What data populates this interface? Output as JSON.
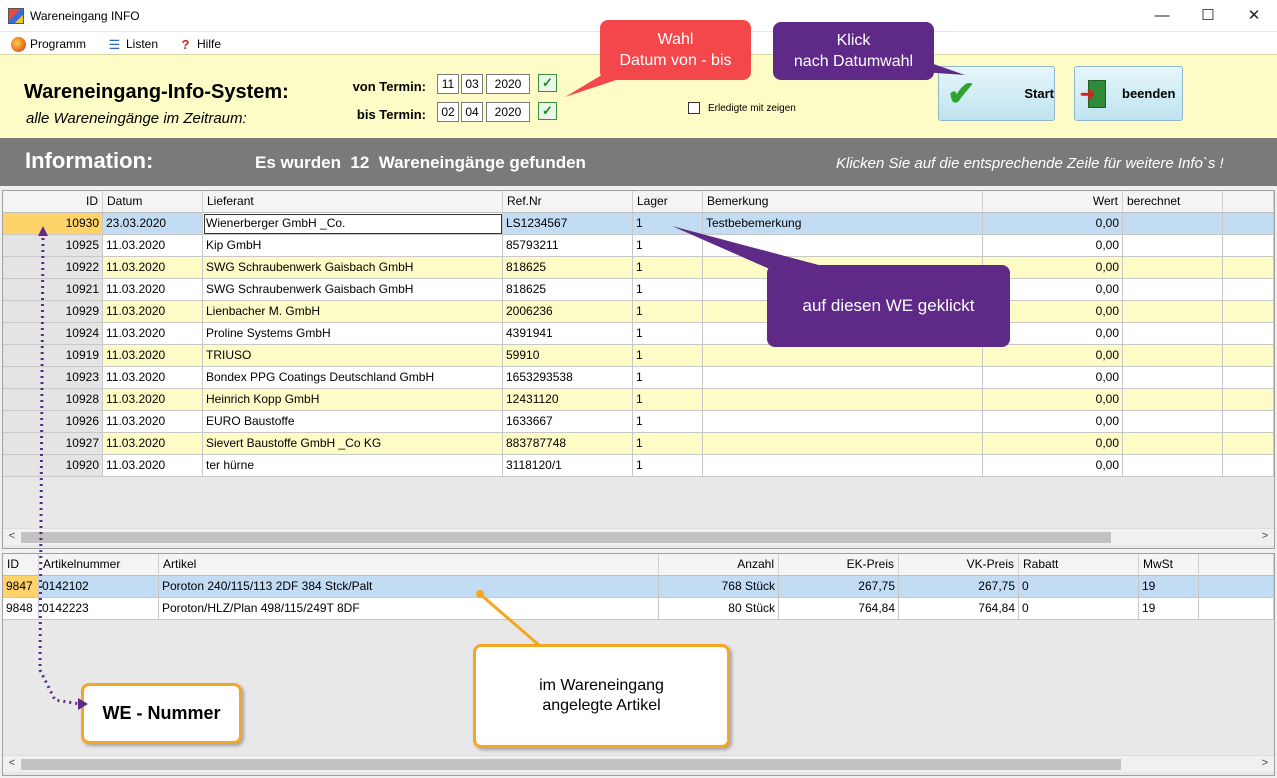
{
  "window": {
    "title": "Wareneingang INFO",
    "minimize": "—",
    "maximize": "☐",
    "close": "✕"
  },
  "menu": [
    {
      "label": "Programm",
      "icon": "program-icon"
    },
    {
      "label": "Listen",
      "icon": "list-icon"
    },
    {
      "label": "Hilfe",
      "icon": "help-icon"
    }
  ],
  "header": {
    "title": "Wareneingang-Info-System:",
    "subtitle": "alle Wareneingänge im Zeitraum:",
    "von_label": "von Termin:",
    "bis_label": "bis Termin:",
    "von": {
      "day": "11",
      "month": "03",
      "year": "2020"
    },
    "bis": {
      "day": "02",
      "month": "04",
      "year": "2020"
    },
    "checkbox_label": "Erledigte mit zeigen",
    "checkbox_checked": false,
    "start_label": "Start",
    "end_label": "beenden"
  },
  "info": {
    "title": "Information:",
    "message": "Es wurden  12  Wareneingänge gefunden",
    "hint": "Klicken Sie auf die entsprechende Zeile für weitere Info`s !"
  },
  "top_table": {
    "columns": [
      "ID",
      "Datum",
      "Lieferant",
      "Ref.Nr",
      "Lager",
      "Bemerkung",
      "Wert",
      "berechnet"
    ],
    "rows": [
      [
        "10930",
        "23.03.2020",
        "Wienerberger GmbH _Co.",
        "LS1234567",
        "1",
        "Testbebemerkung",
        "0,00",
        ""
      ],
      [
        "10925",
        "11.03.2020",
        "Kip GmbH",
        "85793211",
        "1",
        "",
        "0,00",
        ""
      ],
      [
        "10922",
        "11.03.2020",
        "SWG Schraubenwerk Gaisbach GmbH",
        "818625",
        "1",
        "",
        "0,00",
        ""
      ],
      [
        "10921",
        "11.03.2020",
        "SWG Schraubenwerk Gaisbach GmbH",
        "818625",
        "1",
        "",
        "0,00",
        ""
      ],
      [
        "10929",
        "11.03.2020",
        "Lienbacher M. GmbH",
        "2006236",
        "1",
        "",
        "0,00",
        ""
      ],
      [
        "10924",
        "11.03.2020",
        "Proline Systems GmbH",
        "4391941",
        "1",
        "",
        "0,00",
        ""
      ],
      [
        "10919",
        "11.03.2020",
        "TRIUSO",
        "59910",
        "1",
        "",
        "0,00",
        ""
      ],
      [
        "10923",
        "11.03.2020",
        "Bondex PPG Coatings  Deutschland GmbH",
        "1653293538",
        "1",
        "",
        "0,00",
        ""
      ],
      [
        "10928",
        "11.03.2020",
        "Heinrich Kopp GmbH",
        "12431120",
        "1",
        "",
        "0,00",
        ""
      ],
      [
        "10926",
        "11.03.2020",
        "EURO Baustoffe",
        "1633667",
        "1",
        "",
        "0,00",
        ""
      ],
      [
        "10927",
        "11.03.2020",
        "Sievert Baustoffe GmbH _Co KG",
        "883787748",
        "1",
        "",
        "0,00",
        ""
      ],
      [
        "10920",
        "11.03.2020",
        "ter hürne",
        "3118120/1",
        "1",
        "",
        "0,00",
        ""
      ]
    ]
  },
  "bottom_table": {
    "columns": [
      "ID",
      "Artikelnummer",
      "Artikel",
      "Anzahl",
      "EK-Preis",
      "VK-Preis",
      "Rabatt",
      "MwSt"
    ],
    "rows": [
      [
        "9847",
        "0142102",
        "Poroton 240/115/113  2DF 384 Stck/Palt",
        "768 Stück",
        "267,75",
        "267,75",
        "0",
        "19"
      ],
      [
        "9848",
        "0142223",
        "Poroton/HLZ/Plan 498/115/249T  8DF",
        "80 Stück",
        "764,84",
        "764,84",
        "0",
        "19"
      ]
    ]
  },
  "callouts": {
    "wahl": "Wahl\nDatum von - bis",
    "klick": "Klick\nnach Datumwahl",
    "geklickt": "auf diesen WE geklickt",
    "artikel": "im Wareneingang\nangelegte Artikel",
    "we_nummer": "WE - Nummer"
  },
  "colors": {
    "header_bg": "#fdfbc6",
    "info_bar": "#7a7a7a",
    "row_yellow": "#fdfbc6",
    "selected": "#c2dcf3",
    "red_callout": "#f4474b",
    "purple_callout": "#5f2a87",
    "orange_callout": "#f5a623"
  }
}
